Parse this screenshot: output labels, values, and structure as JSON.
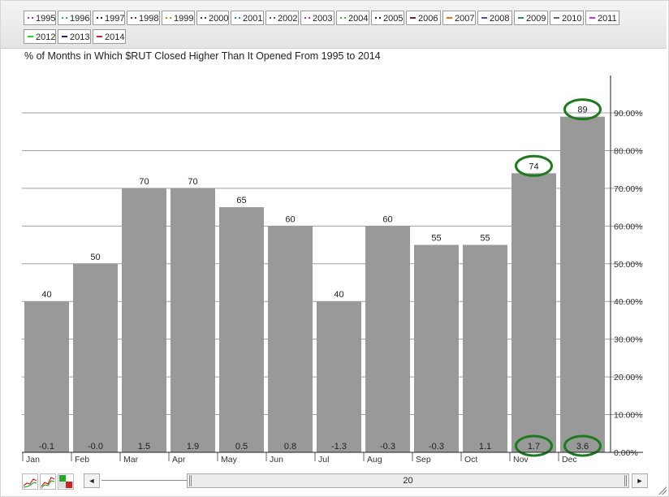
{
  "legend": [
    {
      "label": "1995",
      "color": "#b02fb0",
      "style": "dots"
    },
    {
      "label": "1996",
      "color": "#33b533",
      "style": "dots"
    },
    {
      "label": "1997",
      "color": "#222222",
      "style": "dots"
    },
    {
      "label": "1998",
      "color": "#7a2a2a",
      "style": "dots"
    },
    {
      "label": "1999",
      "color": "#e07a10",
      "style": "dots"
    },
    {
      "label": "2000",
      "color": "#3a3a7a",
      "style": "dots"
    },
    {
      "label": "2001",
      "color": "#2a8a8a",
      "style": "dots"
    },
    {
      "label": "2002",
      "color": "#555555",
      "style": "dots"
    },
    {
      "label": "2003",
      "color": "#b02fb0",
      "style": "dots"
    },
    {
      "label": "2004",
      "color": "#33b533",
      "style": "dots"
    },
    {
      "label": "2005",
      "color": "#222222",
      "style": "dots"
    },
    {
      "label": "2006",
      "color": "#8a1a1a",
      "style": "solid"
    },
    {
      "label": "2007",
      "color": "#e07a10",
      "style": "solid"
    },
    {
      "label": "2008",
      "color": "#6a3a9a",
      "style": "solid"
    },
    {
      "label": "2009",
      "color": "#2a8a8a",
      "style": "solid"
    },
    {
      "label": "2010",
      "color": "#666666",
      "style": "solid"
    },
    {
      "label": "2011",
      "color": "#cc33cc",
      "style": "solid"
    },
    {
      "label": "2012",
      "color": "#33cc33",
      "style": "solid"
    },
    {
      "label": "2013",
      "color": "#222266",
      "style": "solid"
    },
    {
      "label": "2014",
      "color": "#cc2222",
      "style": "solid"
    }
  ],
  "chart_data": {
    "type": "bar",
    "title": "% of Months in Which $RUT Closed Higher Than It Opened From 1995 to 2014",
    "categories": [
      "Jan",
      "Feb",
      "Mar",
      "Apr",
      "May",
      "Jun",
      "Jul",
      "Aug",
      "Sep",
      "Oct",
      "Nov",
      "Dec"
    ],
    "values": [
      40,
      50,
      70,
      70,
      65,
      60,
      40,
      60,
      55,
      55,
      74,
      89
    ],
    "bottom_labels": [
      "-0.1",
      "-0.0",
      "1.5",
      "1.9",
      "0.5",
      "0.8",
      "-1.3",
      "-0.3",
      "-0.3",
      "1.1",
      "1.7",
      "3.6"
    ],
    "y_ticks": [
      "0.00%",
      "10.00%",
      "20.00%",
      "30.00%",
      "40.00%",
      "50.00%",
      "60.00%",
      "70.00%",
      "80.00%",
      "90.00%"
    ],
    "ylim": [
      0,
      100
    ],
    "bar_color": "#999999",
    "highlight_color": "#1e7a1e",
    "highlighted_value_labels": [
      10,
      11
    ],
    "highlighted_bottom_labels": [
      10,
      11
    ],
    "grid": true
  },
  "controls": {
    "scroll_value": "20",
    "scroll_left": "◄",
    "scroll_right": "►"
  }
}
